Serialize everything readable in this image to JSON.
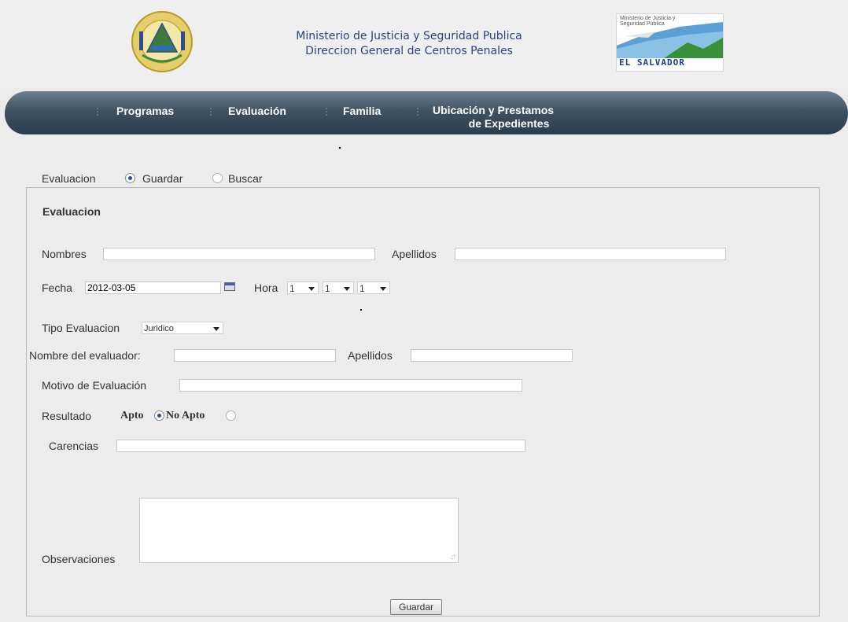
{
  "header": {
    "title_line1": "Ministerio de Justicia y Seguridad Publica",
    "title_line2": "Direccion General de Centros Penales",
    "logo_caption": "Ministerio de Justicia y Seguridad Pública",
    "logo_name": "EL SALVADOR"
  },
  "nav": {
    "items": [
      {
        "label": "Programas"
      },
      {
        "label": "Evaluación"
      },
      {
        "label": "Familia"
      },
      {
        "label_line1": "Ubicación y Prestamos",
        "label_line2": "de Expedientes"
      }
    ]
  },
  "mode": {
    "label": "Evaluacion",
    "options": [
      {
        "label": "Guardar",
        "selected": true
      },
      {
        "label": "Buscar",
        "selected": false
      }
    ]
  },
  "form": {
    "title": "Evaluacion",
    "nombres_label": "Nombres",
    "nombres_value": "",
    "apellidos_label": "Apellidos",
    "apellidos_value": "",
    "fecha_label": "Fecha",
    "fecha_value": "2012-03-05",
    "hora_label": "Hora",
    "hora_values": [
      "1",
      "1",
      "1"
    ],
    "tipo_label": "Tipo Evaluacion",
    "tipo_value": "Juridico",
    "evaluador_label": "Nombre del evaluador:",
    "evaluador_value": "",
    "evaluador_apellidos_label": "Apellidos",
    "evaluador_apellidos_value": "",
    "motivo_label": "Motivo de Evaluación",
    "motivo_value": "",
    "resultado_label": "Resultado",
    "resultado_options": [
      {
        "label": "Apto",
        "selected": true
      },
      {
        "label": "No Apto",
        "selected": false
      }
    ],
    "carencias_label": "Carencias",
    "carencias_value": "",
    "observaciones_label": "Observaciones",
    "observaciones_value": "",
    "submit_label": "Guardar"
  },
  "colors": {
    "nav_bar": "#3f5264",
    "header_text": "#2f3f7f",
    "page_bg": "#ececec"
  }
}
